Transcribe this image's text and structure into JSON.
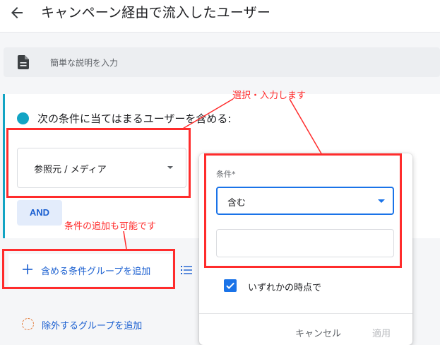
{
  "header": {
    "title": "キャンペーン経由で流入したユーザー"
  },
  "description": {
    "placeholder": "簡単な説明を入力"
  },
  "include_group": {
    "heading": "次の条件に当てはまるユーザーを含める:",
    "dimension": "参照元 / メディア",
    "and_label": "AND",
    "add_group_label": "含める条件グループを追加"
  },
  "exclude": {
    "add_label": "除外するグループを追加"
  },
  "popup": {
    "condition_label": "条件*",
    "match_type": "含む",
    "value": "",
    "any_time_checked": true,
    "any_time_label": "いずれかの時点で",
    "cancel_label": "キャンセル",
    "apply_label": "適用"
  },
  "annotations": {
    "select_note": "選択・入力します",
    "add_note": "条件の追加も可能です"
  },
  "colors": {
    "accent_blue": "#1a73e8",
    "link_blue": "#1a5fd0",
    "teal": "#12a4c4",
    "annotation_red": "#ff2c2c",
    "exclude_orange": "#e37c3b"
  },
  "icons": {
    "back": "arrow-left-icon",
    "description": "document-icon",
    "add": "plus-icon",
    "list": "list-icon",
    "exclude": "dashed-circle-icon",
    "checkbox": "checkmark-icon"
  }
}
